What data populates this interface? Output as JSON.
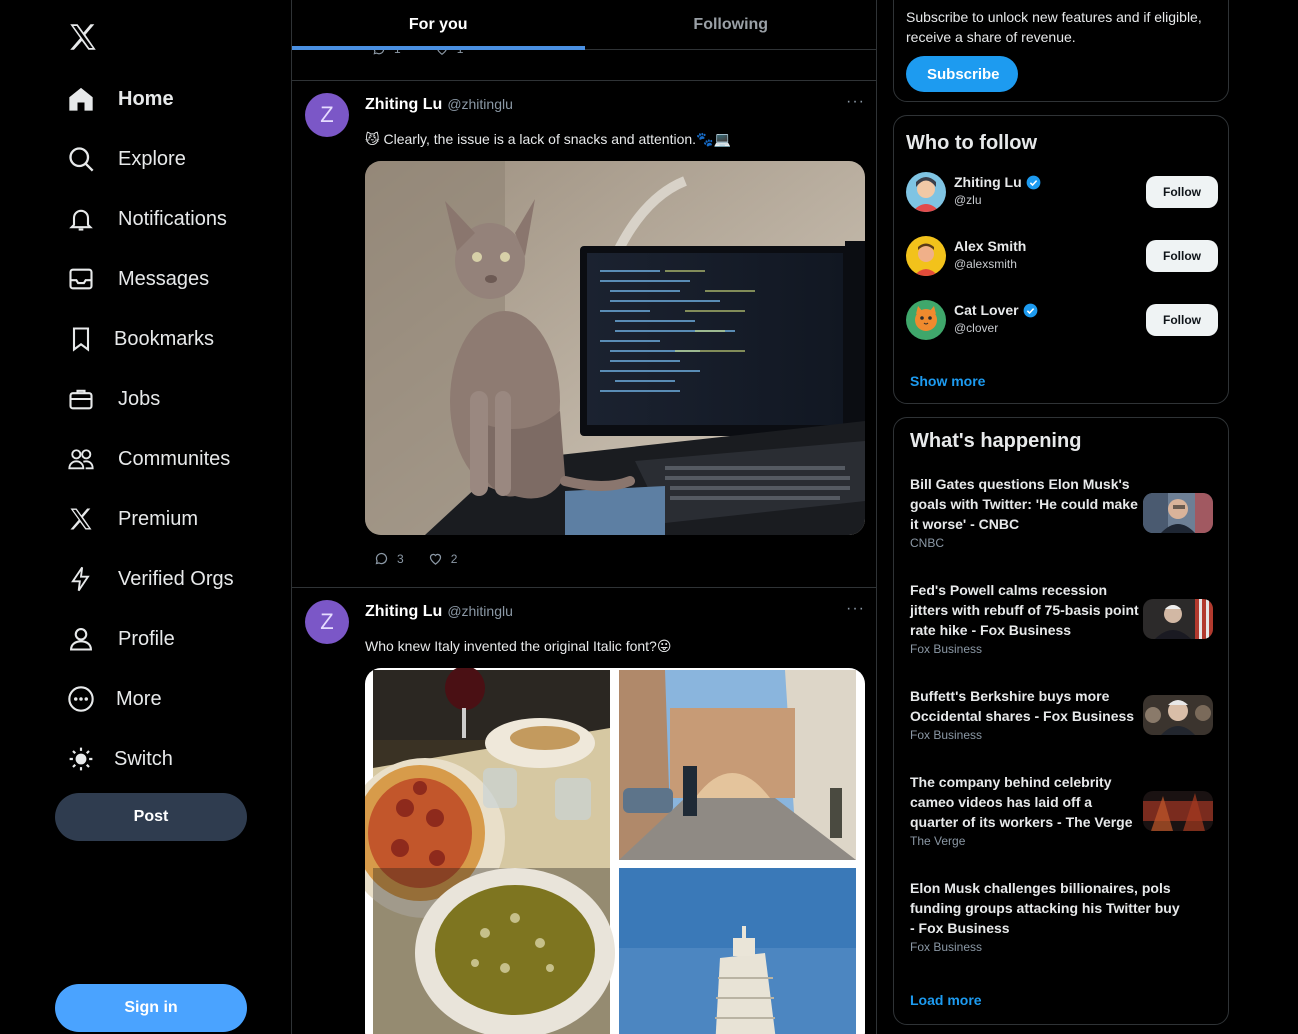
{
  "nav": {
    "items": [
      {
        "label": "Home",
        "icon": "home-icon"
      },
      {
        "label": "Explore",
        "icon": "search-icon"
      },
      {
        "label": "Notifications",
        "icon": "bell-icon"
      },
      {
        "label": "Messages",
        "icon": "inbox-icon"
      },
      {
        "label": "Bookmarks",
        "icon": "bookmark-icon"
      },
      {
        "label": "Jobs",
        "icon": "briefcase-icon"
      },
      {
        "label": "Communites",
        "icon": "people-icon"
      },
      {
        "label": "Premium",
        "icon": "x-logo-icon"
      },
      {
        "label": "Verified Orgs",
        "icon": "lightning-icon"
      },
      {
        "label": "Profile",
        "icon": "person-icon"
      },
      {
        "label": "More",
        "icon": "more-circle-icon"
      },
      {
        "label": "Switch",
        "icon": "sun-icon"
      }
    ],
    "post_label": "Post",
    "signin_label": "Sign in"
  },
  "tabs": [
    "For you",
    "Following"
  ],
  "previous_tweet": {
    "replies": "1",
    "likes": "1"
  },
  "tweets": [
    {
      "avatar_letter": "Z",
      "name": "Zhiting Lu",
      "handle": "@zhitinglu",
      "text": "😼 Clearly, the issue is a lack of snacks and attention.🐾💻",
      "replies": "3",
      "likes": "2"
    },
    {
      "avatar_letter": "Z",
      "name": "Zhiting Lu",
      "handle": "@zhitinglu",
      "text": "Who knew Italy invented the original Italic font?😛"
    }
  ],
  "premium": {
    "text": "Subscribe to unlock new features and if eligible, receive a share of revenue.",
    "button": "Subscribe"
  },
  "who_to_follow": {
    "title": "Who to follow",
    "users": [
      {
        "name": "Zhiting Lu",
        "handle": "@zlu",
        "verified": true
      },
      {
        "name": "Alex Smith",
        "handle": "@alexsmith",
        "verified": false
      },
      {
        "name": "Cat Lover",
        "handle": "@clover",
        "verified": true
      }
    ],
    "follow_label": "Follow",
    "show_more": "Show more"
  },
  "happening": {
    "title": "What's happening",
    "trends": [
      {
        "title": "Bill Gates questions Elon Musk's goals with Twitter: 'He could make it worse' - CNBC",
        "source": "CNBC"
      },
      {
        "title": "Fed's Powell calms recession jitters with rebuff of 75-basis point rate hike - Fox Business",
        "source": "Fox Business"
      },
      {
        "title": "Buffett's Berkshire buys more Occidental shares - Fox Business",
        "source": "Fox Business"
      },
      {
        "title": "The company behind celebrity cameo videos has laid off a quarter of its workers - The Verge",
        "source": "The Verge"
      },
      {
        "title": "Elon Musk challenges billionaires, pols funding groups attacking his Twitter buy - Fox Business",
        "source": "Fox Business"
      }
    ],
    "load_more": "Load more"
  },
  "colors": {
    "accent": "#1d9bf0",
    "tab_indicator": "#4a90e2",
    "post_button": "#2f3c4f",
    "signin_button": "#4aa3ff",
    "avatar": "#7b57c7",
    "border": "#2f3336"
  }
}
